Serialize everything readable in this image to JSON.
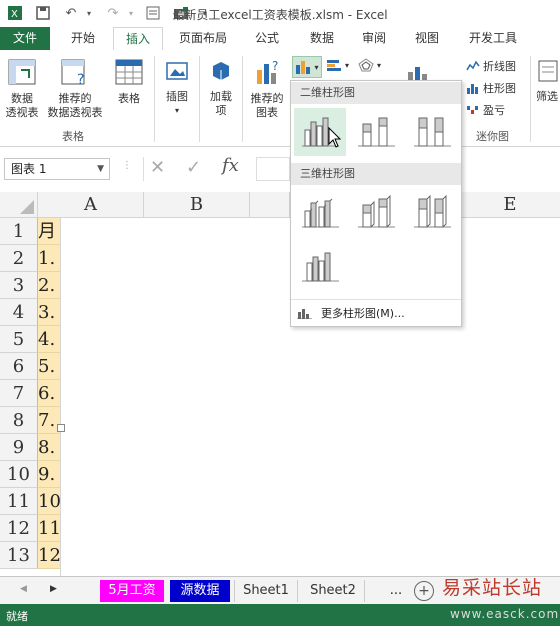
{
  "window": {
    "title": "最新员工excel工资表模板.xlsm - Excel"
  },
  "quick_access": {
    "save_icon": "save-icon",
    "undo_icon": "undo-icon",
    "redo_icon": "redo-icon"
  },
  "tabs": [
    "文件",
    "开始",
    "插入",
    "页面布局",
    "公式",
    "数据",
    "审阅",
    "视图",
    "开发工具"
  ],
  "active_tab": "插入",
  "ribbon": {
    "pivot_table": "数据\n透视表",
    "pivot_table_l1": "数据",
    "pivot_table_l2": "透视表",
    "recommended_pivot_l1": "推荐的",
    "recommended_pivot_l2": "数据透视表",
    "table": "表格",
    "group_tables": "表格",
    "illustrations": "插图",
    "addins_l1": "加载",
    "addins_l2": "项",
    "recommended_charts_l1": "推荐的",
    "recommended_charts_l2": "图表",
    "sparkline_line": "折线图",
    "sparkline_column": "柱形图",
    "sparkline_winloss": "盈亏",
    "group_sparklines": "迷你图",
    "filter": "筛选"
  },
  "formula_bar": {
    "name_box": "图表 1",
    "fx": "fx"
  },
  "columns": [
    "A",
    "B",
    "E"
  ],
  "rows": [
    "1",
    "2",
    "3",
    "4",
    "5",
    "6",
    "7",
    "8",
    "9",
    "10",
    "11",
    "12",
    "13"
  ],
  "column_a_cells": [
    "月",
    "1.",
    "2.",
    "3.",
    "4.",
    "5.",
    "6.",
    "7.",
    "8.",
    "9.",
    "10",
    "11",
    "12"
  ],
  "dropdown": {
    "section_2d": "二维柱形图",
    "section_3d": "三维柱形图",
    "more": "更多柱形图(M)..."
  },
  "sheets": [
    {
      "name": "5月工资",
      "color": "#ff00ff",
      "text_color": "#ffffff"
    },
    {
      "name": "源数据",
      "color": "#0000cc",
      "text_color": "#ffffff"
    },
    {
      "name": "Sheet1",
      "color": "",
      "text_color": "#333333"
    },
    {
      "name": "Sheet2",
      "color": "",
      "text_color": "#333333"
    }
  ],
  "sheet_more": "...",
  "status": {
    "ready": "就绪"
  },
  "watermark": {
    "text": "易采站长站",
    "url": "www.easck.com"
  },
  "colors": {
    "excel_green": "#217346",
    "highlight": "#fde9b8"
  }
}
